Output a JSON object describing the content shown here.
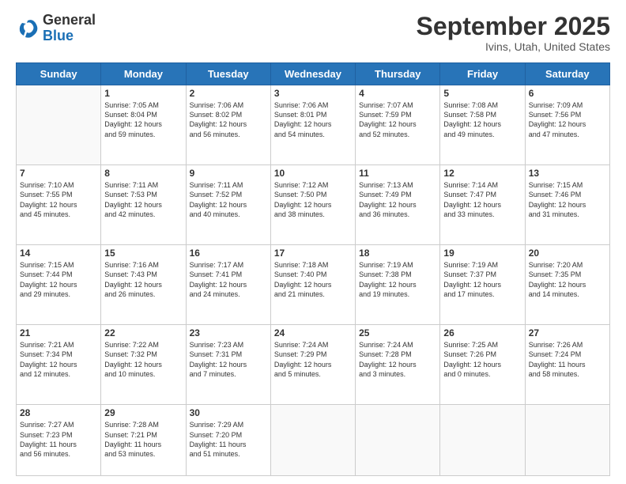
{
  "logo": {
    "general": "General",
    "blue": "Blue"
  },
  "title": "September 2025",
  "location": "Ivins, Utah, United States",
  "days_header": [
    "Sunday",
    "Monday",
    "Tuesday",
    "Wednesday",
    "Thursday",
    "Friday",
    "Saturday"
  ],
  "weeks": [
    [
      {
        "day": "",
        "info": ""
      },
      {
        "day": "1",
        "info": "Sunrise: 7:05 AM\nSunset: 8:04 PM\nDaylight: 12 hours\nand 59 minutes."
      },
      {
        "day": "2",
        "info": "Sunrise: 7:06 AM\nSunset: 8:02 PM\nDaylight: 12 hours\nand 56 minutes."
      },
      {
        "day": "3",
        "info": "Sunrise: 7:06 AM\nSunset: 8:01 PM\nDaylight: 12 hours\nand 54 minutes."
      },
      {
        "day": "4",
        "info": "Sunrise: 7:07 AM\nSunset: 7:59 PM\nDaylight: 12 hours\nand 52 minutes."
      },
      {
        "day": "5",
        "info": "Sunrise: 7:08 AM\nSunset: 7:58 PM\nDaylight: 12 hours\nand 49 minutes."
      },
      {
        "day": "6",
        "info": "Sunrise: 7:09 AM\nSunset: 7:56 PM\nDaylight: 12 hours\nand 47 minutes."
      }
    ],
    [
      {
        "day": "7",
        "info": "Sunrise: 7:10 AM\nSunset: 7:55 PM\nDaylight: 12 hours\nand 45 minutes."
      },
      {
        "day": "8",
        "info": "Sunrise: 7:11 AM\nSunset: 7:53 PM\nDaylight: 12 hours\nand 42 minutes."
      },
      {
        "day": "9",
        "info": "Sunrise: 7:11 AM\nSunset: 7:52 PM\nDaylight: 12 hours\nand 40 minutes."
      },
      {
        "day": "10",
        "info": "Sunrise: 7:12 AM\nSunset: 7:50 PM\nDaylight: 12 hours\nand 38 minutes."
      },
      {
        "day": "11",
        "info": "Sunrise: 7:13 AM\nSunset: 7:49 PM\nDaylight: 12 hours\nand 36 minutes."
      },
      {
        "day": "12",
        "info": "Sunrise: 7:14 AM\nSunset: 7:47 PM\nDaylight: 12 hours\nand 33 minutes."
      },
      {
        "day": "13",
        "info": "Sunrise: 7:15 AM\nSunset: 7:46 PM\nDaylight: 12 hours\nand 31 minutes."
      }
    ],
    [
      {
        "day": "14",
        "info": "Sunrise: 7:15 AM\nSunset: 7:44 PM\nDaylight: 12 hours\nand 29 minutes."
      },
      {
        "day": "15",
        "info": "Sunrise: 7:16 AM\nSunset: 7:43 PM\nDaylight: 12 hours\nand 26 minutes."
      },
      {
        "day": "16",
        "info": "Sunrise: 7:17 AM\nSunset: 7:41 PM\nDaylight: 12 hours\nand 24 minutes."
      },
      {
        "day": "17",
        "info": "Sunrise: 7:18 AM\nSunset: 7:40 PM\nDaylight: 12 hours\nand 21 minutes."
      },
      {
        "day": "18",
        "info": "Sunrise: 7:19 AM\nSunset: 7:38 PM\nDaylight: 12 hours\nand 19 minutes."
      },
      {
        "day": "19",
        "info": "Sunrise: 7:19 AM\nSunset: 7:37 PM\nDaylight: 12 hours\nand 17 minutes."
      },
      {
        "day": "20",
        "info": "Sunrise: 7:20 AM\nSunset: 7:35 PM\nDaylight: 12 hours\nand 14 minutes."
      }
    ],
    [
      {
        "day": "21",
        "info": "Sunrise: 7:21 AM\nSunset: 7:34 PM\nDaylight: 12 hours\nand 12 minutes."
      },
      {
        "day": "22",
        "info": "Sunrise: 7:22 AM\nSunset: 7:32 PM\nDaylight: 12 hours\nand 10 minutes."
      },
      {
        "day": "23",
        "info": "Sunrise: 7:23 AM\nSunset: 7:31 PM\nDaylight: 12 hours\nand 7 minutes."
      },
      {
        "day": "24",
        "info": "Sunrise: 7:24 AM\nSunset: 7:29 PM\nDaylight: 12 hours\nand 5 minutes."
      },
      {
        "day": "25",
        "info": "Sunrise: 7:24 AM\nSunset: 7:28 PM\nDaylight: 12 hours\nand 3 minutes."
      },
      {
        "day": "26",
        "info": "Sunrise: 7:25 AM\nSunset: 7:26 PM\nDaylight: 12 hours\nand 0 minutes."
      },
      {
        "day": "27",
        "info": "Sunrise: 7:26 AM\nSunset: 7:24 PM\nDaylight: 11 hours\nand 58 minutes."
      }
    ],
    [
      {
        "day": "28",
        "info": "Sunrise: 7:27 AM\nSunset: 7:23 PM\nDaylight: 11 hours\nand 56 minutes."
      },
      {
        "day": "29",
        "info": "Sunrise: 7:28 AM\nSunset: 7:21 PM\nDaylight: 11 hours\nand 53 minutes."
      },
      {
        "day": "30",
        "info": "Sunrise: 7:29 AM\nSunset: 7:20 PM\nDaylight: 11 hours\nand 51 minutes."
      },
      {
        "day": "",
        "info": ""
      },
      {
        "day": "",
        "info": ""
      },
      {
        "day": "",
        "info": ""
      },
      {
        "day": "",
        "info": ""
      }
    ]
  ]
}
